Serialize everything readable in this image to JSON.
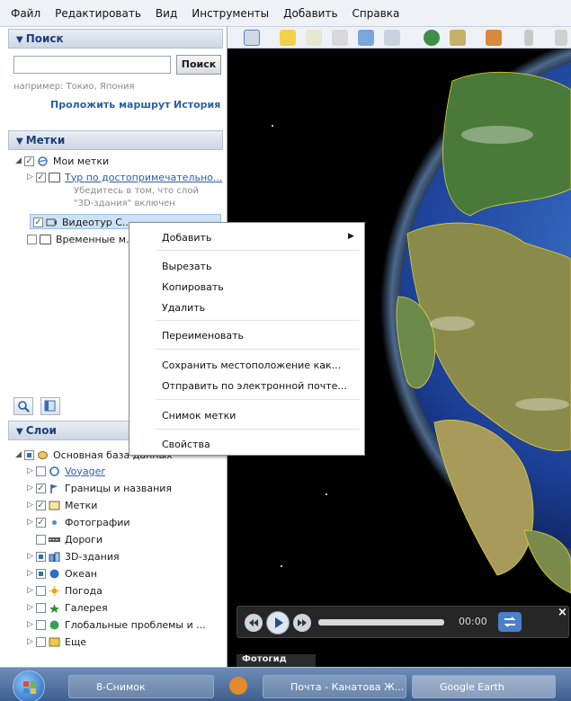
{
  "menubar": [
    "Файл",
    "Редактировать",
    "Вид",
    "Инструменты",
    "Добавить",
    "Справка"
  ],
  "search": {
    "header": "Поиск",
    "input_value": "",
    "button": "Поиск",
    "hint": "например: Токио, Япония",
    "route_link": "Проложить маршрут",
    "history_link": "История"
  },
  "places": {
    "header": "Метки",
    "my_places": "Мои метки",
    "tour": "Тур по достопримечательно...",
    "tour_note_1": "Убедитесь в том, что слой",
    "tour_note_2": "\"3D-здания\" включен",
    "videotour": "Видеотур С...",
    "temporary": "Временные м..."
  },
  "layers": {
    "header": "Слои",
    "root": "Основная база данных",
    "items": [
      "Voyager",
      "Границы и названия",
      "Метки",
      "Фотографии",
      "Дороги",
      "3D-здания",
      "Океан",
      "Погода",
      "Галерея",
      "Глобальные проблемы и ...",
      "Еще"
    ]
  },
  "context_menu": {
    "add": "Добавить",
    "cut": "Вырезать",
    "copy": "Копировать",
    "delete": "Удалить",
    "rename": "Переименовать",
    "save_as": "Сохранить местоположение как...",
    "email": "Отправить по электронной почте...",
    "snapshot": "Снимок метки",
    "properties": "Свойства"
  },
  "player": {
    "time": "00:00"
  },
  "fotogid": "Фотогид",
  "taskbar": [
    "8-Снимок",
    "Почта - Канатова Ж...",
    "Google Earth"
  ],
  "colors": {
    "accent": "#1c3f7a",
    "link": "#2a5fa8",
    "selection": "#cfe1f6"
  }
}
